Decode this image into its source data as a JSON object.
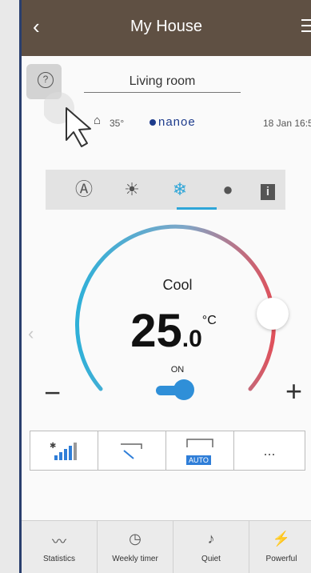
{
  "header": {
    "title": "My House",
    "back_icon": "chevron-left-icon",
    "menu_icon": "hamburger-menu-icon"
  },
  "room": {
    "name": "Living room"
  },
  "status": {
    "outdoor_temp": "35°",
    "brand": "nanoe",
    "datetime": "18 Jan 16:5"
  },
  "modes": [
    {
      "name": "auto",
      "icon": "auto-mode-icon",
      "glyph": "Ⓐ"
    },
    {
      "name": "heat",
      "icon": "sun-icon",
      "glyph": "☀"
    },
    {
      "name": "cool",
      "icon": "snowflake-icon",
      "glyph": "❄"
    },
    {
      "name": "dry",
      "icon": "drop-icon",
      "glyph": "💧"
    },
    {
      "name": "info",
      "icon": "info-icon",
      "glyph": "ℹ"
    }
  ],
  "active_mode": "cool",
  "control": {
    "mode_label": "Cool",
    "temp_int": "25",
    "temp_dec": ".0",
    "temp_unit": "°C",
    "power_label": "ON",
    "power_on": true,
    "minus_label": "−",
    "plus_label": "+"
  },
  "functions": [
    {
      "name": "fan-speed",
      "icon": "fan-speed-icon"
    },
    {
      "name": "air-swing",
      "icon": "swing-icon"
    },
    {
      "name": "auto-swing",
      "icon": "auto-swing-icon",
      "badge": "AUTO"
    },
    {
      "name": "more",
      "icon": "more-icon",
      "label": "..."
    }
  ],
  "tabs": [
    {
      "label": "Statistics",
      "icon": "chart-icon"
    },
    {
      "label": "Weekly timer",
      "icon": "clock-icon"
    },
    {
      "label": "Quiet",
      "icon": "quiet-icon"
    },
    {
      "label": "Powerful",
      "icon": "powerful-icon"
    }
  ],
  "colors": {
    "header_bg": "#5f5043",
    "accent": "#2fa6d8",
    "dial_cool": "#2fb0d8",
    "dial_warm": "#e0505a"
  }
}
